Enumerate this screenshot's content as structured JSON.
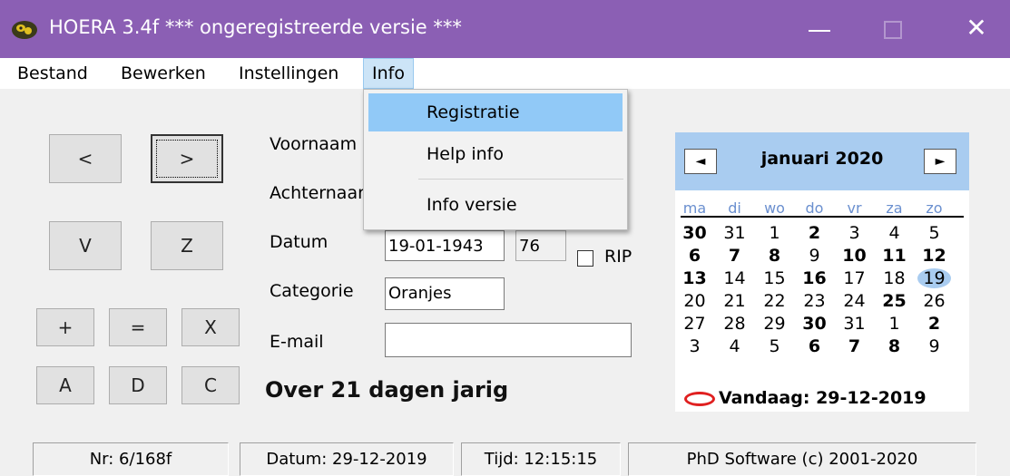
{
  "window": {
    "title": "HOERA 3.4f *** ongeregistreerde versie ***",
    "close_glyph": "✕"
  },
  "menu": [
    "Bestand",
    "Bewerken",
    "Instellingen",
    "Info"
  ],
  "dropdown": {
    "items": [
      "Registratie",
      "Help info",
      "Info versie"
    ]
  },
  "buttons": {
    "prev": "<",
    "next": ">",
    "v": "V",
    "z": "Z",
    "plus": "+",
    "equals": "=",
    "x": "X",
    "a": "A",
    "d": "D",
    "c": "C"
  },
  "form": {
    "voornaam_label": "Voornaam",
    "achternaam_label": "Achternaar",
    "datum_label": "Datum",
    "datum_value": "19-01-1943",
    "age_value": "76",
    "rip_label": "RIP",
    "categorie_label": "Categorie",
    "categorie_value": "Oranjes",
    "email_label": "E-mail",
    "email_value": ""
  },
  "message": "Over 21 dagen jarig",
  "calendar": {
    "title": "januari 2020",
    "prev_glyph": "◄",
    "next_glyph": "►",
    "weekdays": [
      "ma",
      "di",
      "wo",
      "do",
      "vr",
      "za",
      "zo"
    ],
    "weeks": [
      [
        "30",
        "31",
        "1",
        "2",
        "3",
        "4",
        "5"
      ],
      [
        "6",
        "7",
        "8",
        "9",
        "10",
        "11",
        "12"
      ],
      [
        "13",
        "14",
        "15",
        "16",
        "17",
        "18",
        "19"
      ],
      [
        "20",
        "21",
        "22",
        "23",
        "24",
        "25",
        "26"
      ],
      [
        "27",
        "28",
        "29",
        "30",
        "31",
        "1",
        "2"
      ],
      [
        "3",
        "4",
        "5",
        "6",
        "7",
        "8",
        "9"
      ]
    ],
    "bold": [
      [
        0,
        0
      ],
      [
        0,
        3
      ],
      [
        1,
        0
      ],
      [
        1,
        1
      ],
      [
        1,
        2
      ],
      [
        1,
        4
      ],
      [
        1,
        5
      ],
      [
        1,
        6
      ],
      [
        2,
        0
      ],
      [
        2,
        3
      ],
      [
        3,
        5
      ],
      [
        4,
        3
      ],
      [
        4,
        6
      ],
      [
        5,
        3
      ],
      [
        5,
        4
      ],
      [
        5,
        5
      ]
    ],
    "selected": [
      2,
      6
    ],
    "today_text": "Vandaag: 29-12-2019"
  },
  "status": {
    "nr": "Nr: 6/168f",
    "datum": "Datum: 29-12-2019",
    "tijd": "Tijd: 12:15:15",
    "copyright": "PhD Software (c) 2001-2020"
  },
  "colors": {
    "titlebar": "#8b5fb4",
    "menu_highlight": "#91c9f7",
    "calendar_header": "#a9ccf0"
  }
}
